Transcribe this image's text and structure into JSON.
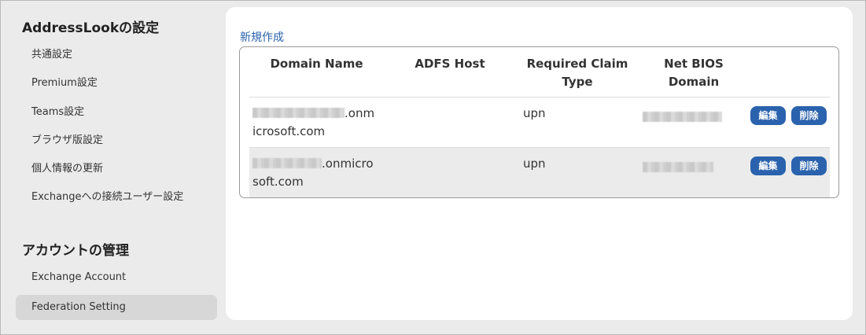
{
  "sidebar": {
    "section1_title": "AddressLookの設定",
    "section1_items": [
      {
        "label": "共通設定"
      },
      {
        "label": "Premium設定"
      },
      {
        "label": "Teams設定"
      },
      {
        "label": "ブラウザ版設定"
      },
      {
        "label": "個人情報の更新"
      },
      {
        "label": "Exchangeへの接続ユーザー設定"
      }
    ],
    "section2_title": "アカウントの管理",
    "section2_items": [
      {
        "label": "Exchange Account"
      },
      {
        "label": "Federation Setting"
      }
    ]
  },
  "main": {
    "new_link": "新規作成",
    "table": {
      "headers": {
        "domain_name": "Domain Name",
        "adfs_host": "ADFS Host",
        "required_claim_type_1": "Required Claim",
        "required_claim_type_2": "Type",
        "net_bios_1": "Net BIOS",
        "net_bios_2": "Domain"
      },
      "rows": [
        {
          "domain_line1_suffix": ".onm",
          "domain_line2": "icrosoft.com",
          "adfs_host": "",
          "claim_type": "upn",
          "edit_label": "編集",
          "delete_label": "削除"
        },
        {
          "domain_line1_suffix": ".onmicro",
          "domain_line2": "soft.com",
          "adfs_host": "",
          "claim_type": "upn",
          "edit_label": "編集",
          "delete_label": "削除"
        }
      ]
    }
  }
}
